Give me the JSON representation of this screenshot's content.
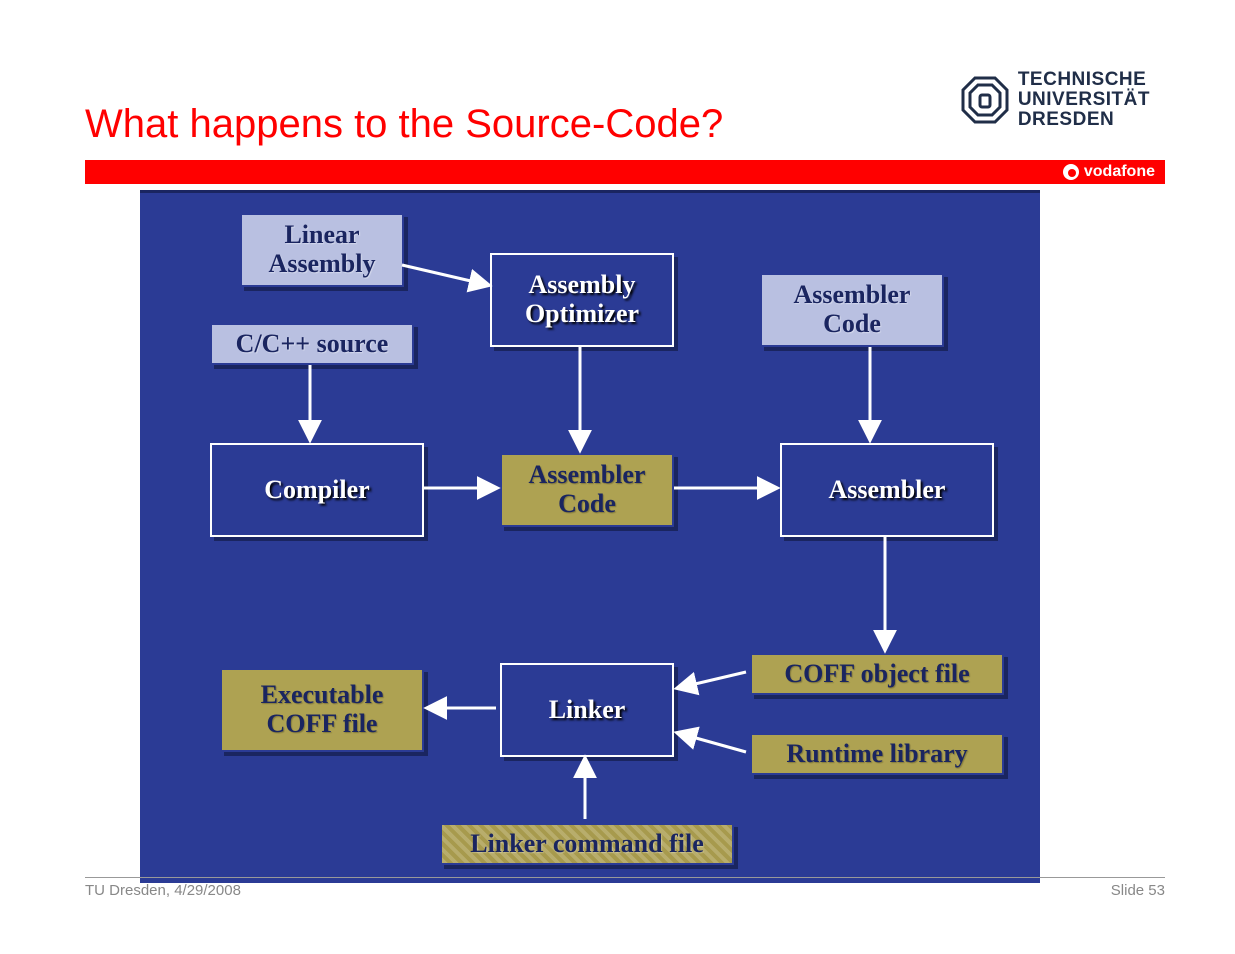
{
  "title": "What happens to the Source-Code?",
  "logo": {
    "line1": "TECHNISCHE",
    "line2": "UNIVERSITÄT",
    "line3": "DRESDEN"
  },
  "brand": "vodafone",
  "footer": {
    "left": "TU Dresden, 4/29/2008",
    "right": "Slide 53"
  },
  "nodes": {
    "linear_assembly": "Linear\nAssembly",
    "c_cpp_source": "C/C++ source",
    "assembly_optimizer": "Assembly\nOptimizer",
    "assembler_code_top": "Assembler\nCode",
    "compiler": "Compiler",
    "assembler_code_mid": "Assembler\nCode",
    "assembler": "Assembler",
    "coff_object": "COFF object file",
    "runtime_library": "Runtime library",
    "linker": "Linker",
    "executable_coff": "Executable\nCOFF file",
    "linker_cmd": "Linker command file"
  },
  "edges": [
    [
      "linear_assembly",
      "assembly_optimizer"
    ],
    [
      "c_cpp_source",
      "compiler"
    ],
    [
      "assembly_optimizer",
      "assembler_code_mid"
    ],
    [
      "compiler",
      "assembler_code_mid"
    ],
    [
      "assembler_code_mid",
      "assembler"
    ],
    [
      "assembler_code_top",
      "assembler"
    ],
    [
      "assembler",
      "coff_object"
    ],
    [
      "coff_object",
      "linker"
    ],
    [
      "runtime_library",
      "linker"
    ],
    [
      "linker_cmd",
      "linker"
    ],
    [
      "linker",
      "executable_coff"
    ]
  ]
}
